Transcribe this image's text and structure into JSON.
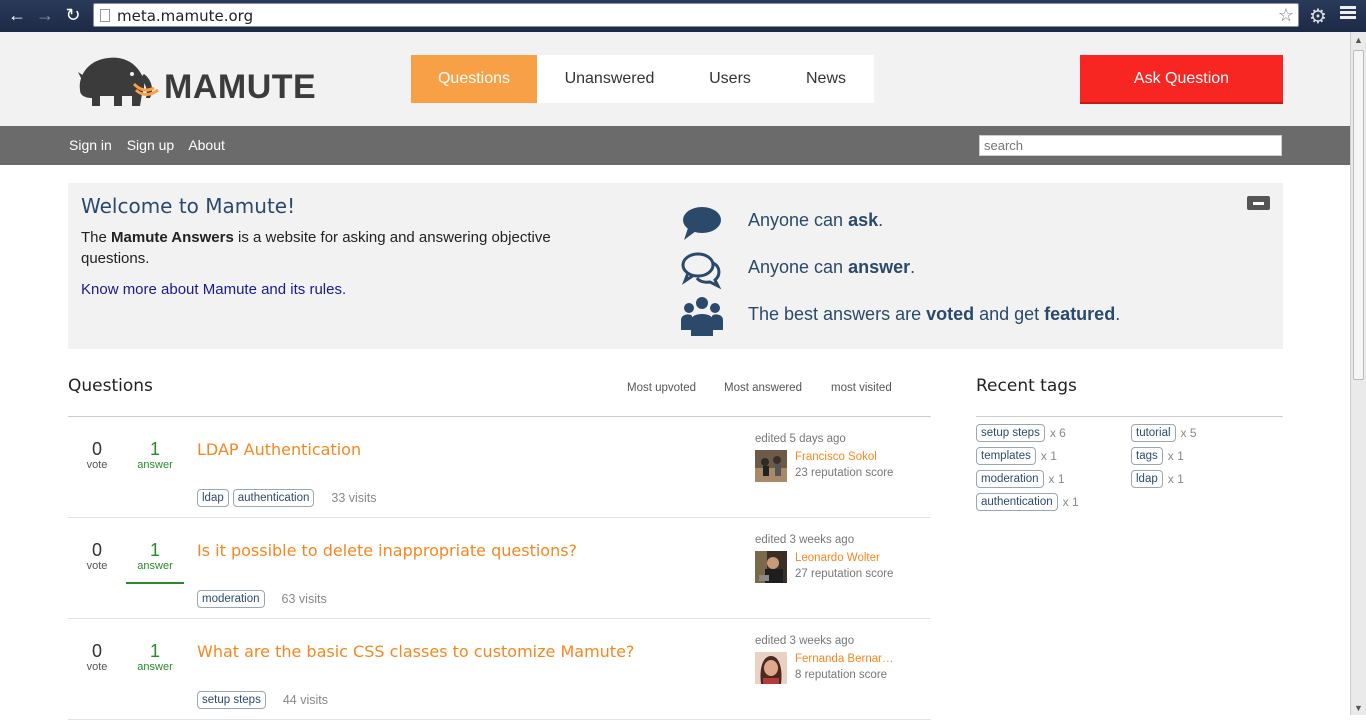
{
  "browser": {
    "url": "meta.mamute.org"
  },
  "header": {
    "logo_text": "MAMUTE",
    "nav": [
      {
        "label": "Questions",
        "active": true
      },
      {
        "label": "Unanswered",
        "active": false
      },
      {
        "label": "Users",
        "active": false
      },
      {
        "label": "News",
        "active": false
      }
    ],
    "ask_button": "Ask Question",
    "accent_color": "#f8a046",
    "ask_color": "#f72622"
  },
  "subbar": {
    "links": [
      "Sign in",
      "Sign up",
      "About"
    ],
    "search_placeholder": "search"
  },
  "welcome": {
    "title": "Welcome to Mamute!",
    "desc_prefix": "The ",
    "desc_bold": "Mamute Answers",
    "desc_suffix": " is a website for asking and answering objective questions.",
    "more_link": "Know more about Mamute and its rules.",
    "features": [
      {
        "icon": "speech-bubble-icon",
        "pre": "Anyone can ",
        "b1": "ask",
        "mid": ".",
        "b2": "",
        "post": ""
      },
      {
        "icon": "chat-bubbles-icon",
        "pre": "Anyone can ",
        "b1": "answer",
        "mid": ".",
        "b2": "",
        "post": ""
      },
      {
        "icon": "group-icon",
        "pre": "The best answers are ",
        "b1": "voted",
        "mid": " and get ",
        "b2": "featured",
        "post": "."
      }
    ]
  },
  "questions": {
    "heading": "Questions",
    "sorts": [
      "Most upvoted",
      "Most answered",
      "most visited"
    ],
    "items": [
      {
        "votes": "0",
        "vote_label": "vote",
        "answers": "1",
        "answer_label": "answer",
        "title": "LDAP Authentication",
        "tags": [
          "ldap",
          "authentication"
        ],
        "visits": "33 visits",
        "edited": "edited 5 days ago",
        "user": "Francisco Sokol",
        "rep": "23 reputation score"
      },
      {
        "votes": "0",
        "vote_label": "vote",
        "answers": "1",
        "answer_label": "answer",
        "title": "Is it possible to delete inappropriate questions?",
        "tags": [
          "moderation"
        ],
        "visits": "63 visits",
        "edited": "edited 3 weeks ago",
        "user": "Leonardo Wolter",
        "rep": "27 reputation score"
      },
      {
        "votes": "0",
        "vote_label": "vote",
        "answers": "1",
        "answer_label": "answer",
        "title": "What are the basic CSS classes to customize Mamute?",
        "tags": [
          "setup steps"
        ],
        "visits": "44 visits",
        "edited": "edited 3 weeks ago",
        "user": "Fernanda Bernar…",
        "rep": "8 reputation score"
      }
    ]
  },
  "recent_tags": {
    "heading": "Recent tags",
    "items": [
      {
        "name": "setup steps",
        "count": "x 6"
      },
      {
        "name": "tutorial",
        "count": "x 5"
      },
      {
        "name": "templates",
        "count": "x 1"
      },
      {
        "name": "tags",
        "count": "x 1"
      },
      {
        "name": "moderation",
        "count": "x 1"
      },
      {
        "name": "ldap",
        "count": "x 1"
      },
      {
        "name": "authentication",
        "count": "x 1"
      }
    ]
  }
}
